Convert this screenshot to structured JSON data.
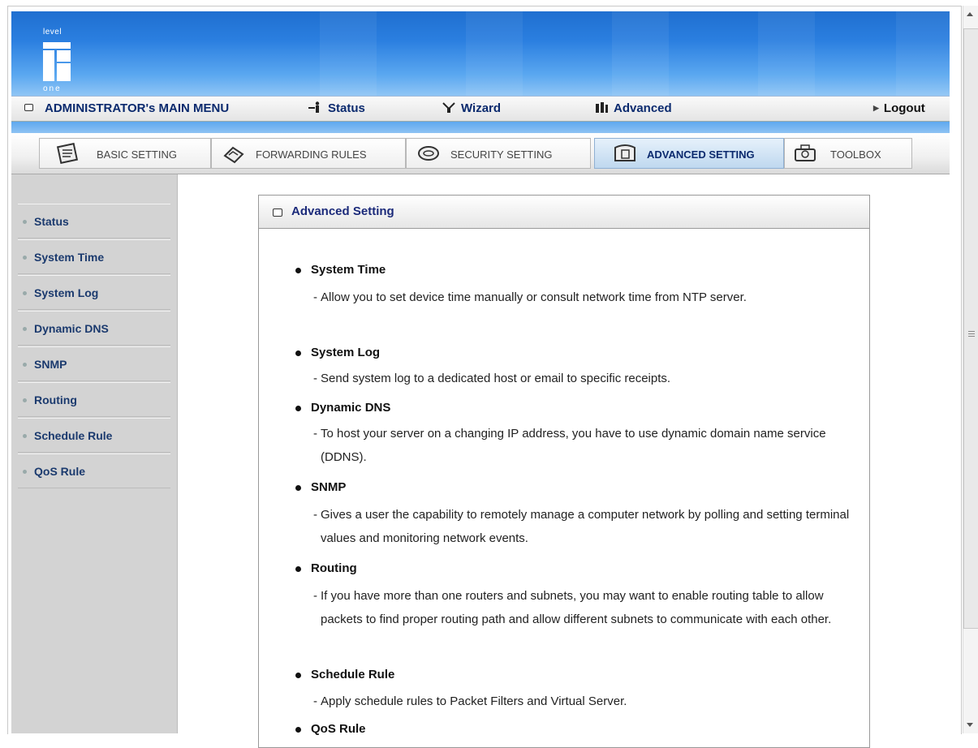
{
  "logo": {
    "top_text": "level",
    "bottom_text": "one"
  },
  "main_menu": {
    "title": "ADMINISTRATOR's MAIN MENU",
    "items": [
      {
        "label": "Status",
        "icon": "status-icon"
      },
      {
        "label": "Wizard",
        "icon": "wizard-icon"
      },
      {
        "label": "Advanced",
        "icon": "advanced-icon"
      }
    ],
    "logout": "Logout"
  },
  "tabs": [
    {
      "label": "BASIC SETTING",
      "icon": "basic-setting-icon",
      "active": false
    },
    {
      "label": "FORWARDING RULES",
      "icon": "forwarding-rules-icon",
      "active": false
    },
    {
      "label": "SECURITY SETTING",
      "icon": "security-setting-icon",
      "active": false
    },
    {
      "label": "ADVANCED SETTING",
      "icon": "advanced-setting-icon",
      "active": true
    },
    {
      "label": "TOOLBOX",
      "icon": "toolbox-icon",
      "active": false
    }
  ],
  "sidebar": {
    "items": [
      {
        "label": "Status"
      },
      {
        "label": "System Time"
      },
      {
        "label": "System Log"
      },
      {
        "label": "Dynamic DNS"
      },
      {
        "label": "SNMP"
      },
      {
        "label": "Routing"
      },
      {
        "label": "Schedule Rule"
      },
      {
        "label": "QoS Rule"
      }
    ]
  },
  "panel": {
    "title": "Advanced Setting",
    "entries": [
      {
        "title": "System Time",
        "desc": "Allow you to set device time manually or consult network time from NTP server."
      },
      {
        "title": "System Log",
        "desc": "Send system log to a dedicated host or email to specific receipts."
      },
      {
        "title": "Dynamic DNS",
        "desc": "To host your server on a changing IP address, you have to use dynamic domain name service (DDNS)."
      },
      {
        "title": "SNMP",
        "desc": "Gives a user the capability to remotely manage a computer network by polling and setting terminal values and monitoring network events."
      },
      {
        "title": "Routing",
        "desc": "If you have more than one routers and subnets, you may want to enable routing table to allow packets to find proper routing path and allow different subnets to communicate with each other."
      },
      {
        "title": "Schedule Rule",
        "desc": "Apply schedule rules to Packet Filters and Virtual Server."
      },
      {
        "title": "QoS Rule",
        "desc": ""
      }
    ]
  },
  "colors": {
    "banner_blue": "#2b7fe0",
    "menu_text": "#0b2a6e",
    "sidebar_bg": "#d3d3d3"
  }
}
